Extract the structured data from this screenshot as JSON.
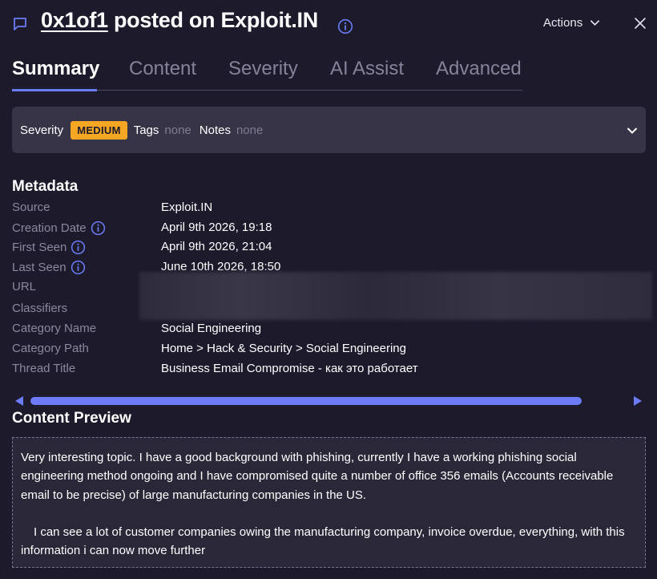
{
  "header": {
    "user": "0x1of1",
    "title_rest": " posted on Exploit.IN",
    "actions_label": "Actions"
  },
  "tabs": [
    {
      "label": "Summary",
      "active": true
    },
    {
      "label": "Content",
      "active": false
    },
    {
      "label": "Severity",
      "active": false
    },
    {
      "label": "AI Assist",
      "active": false
    },
    {
      "label": "Advanced",
      "active": false
    }
  ],
  "severity_bar": {
    "severity_label": "Severity",
    "severity_value": "MEDIUM",
    "tags_label": "Tags",
    "tags_value": "none",
    "notes_label": "Notes",
    "notes_value": "none"
  },
  "metadata": {
    "title": "Metadata",
    "rows": [
      {
        "key": "Source",
        "value": "Exploit.IN"
      },
      {
        "key": "Creation Date",
        "value": "April 9th 2026, 19:18"
      },
      {
        "key": "First Seen",
        "value": "April 9th 2026, 21:04"
      },
      {
        "key": "Last Seen",
        "value": "June 10th 2026, 18:50"
      },
      {
        "key": "URL",
        "value": ""
      },
      {
        "key": "Classifiers",
        "value": ""
      },
      {
        "key": "Category Name",
        "value": "Social Engineering"
      },
      {
        "key": "Category Path",
        "value": "Home > Hack & Security > Social Engineering"
      },
      {
        "key": "Thread Title",
        "value": "Business Email Compromise - как это работает"
      }
    ]
  },
  "content_preview": {
    "title": "Content Preview",
    "paragraph1": "Very interesting topic. I have a good background with phishing, currently I have a working phishing social engineering method ongoing and I have compromised quite a number of office 356 emails (Accounts receivable email to be precise) of large manufacturing companies in the US.",
    "paragraph2": "I can see a lot of customer companies owing the manufacturing company, invoice overdue, everything, with this information i can now move further"
  },
  "colors": {
    "background": "#1c1a2b",
    "accent": "#6b7cf6",
    "severity_medium": "#f5a623",
    "muted_text": "#8b899d"
  },
  "icons": [
    "chat-icon",
    "info-icon",
    "chevron-down-icon",
    "close-icon",
    "arrow-left-icon",
    "arrow-right-icon"
  ]
}
